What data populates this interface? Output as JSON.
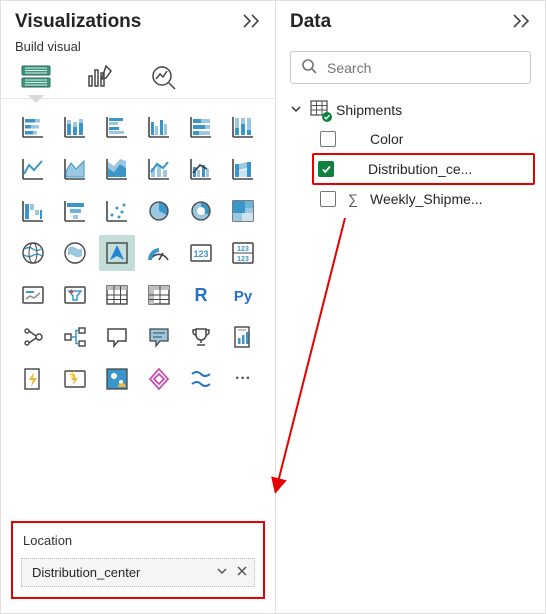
{
  "visualizations": {
    "pane_title": "Visualizations",
    "subtitle": "Build visual",
    "field_well": {
      "label": "Location",
      "field": "Distribution_center"
    },
    "more_icon": "···"
  },
  "data": {
    "pane_title": "Data",
    "search_placeholder": "Search",
    "table_name": "Shipments",
    "fields": {
      "color": "Color",
      "dist": "Distribution_ce...",
      "weekly": "Weekly_Shipme..."
    }
  }
}
